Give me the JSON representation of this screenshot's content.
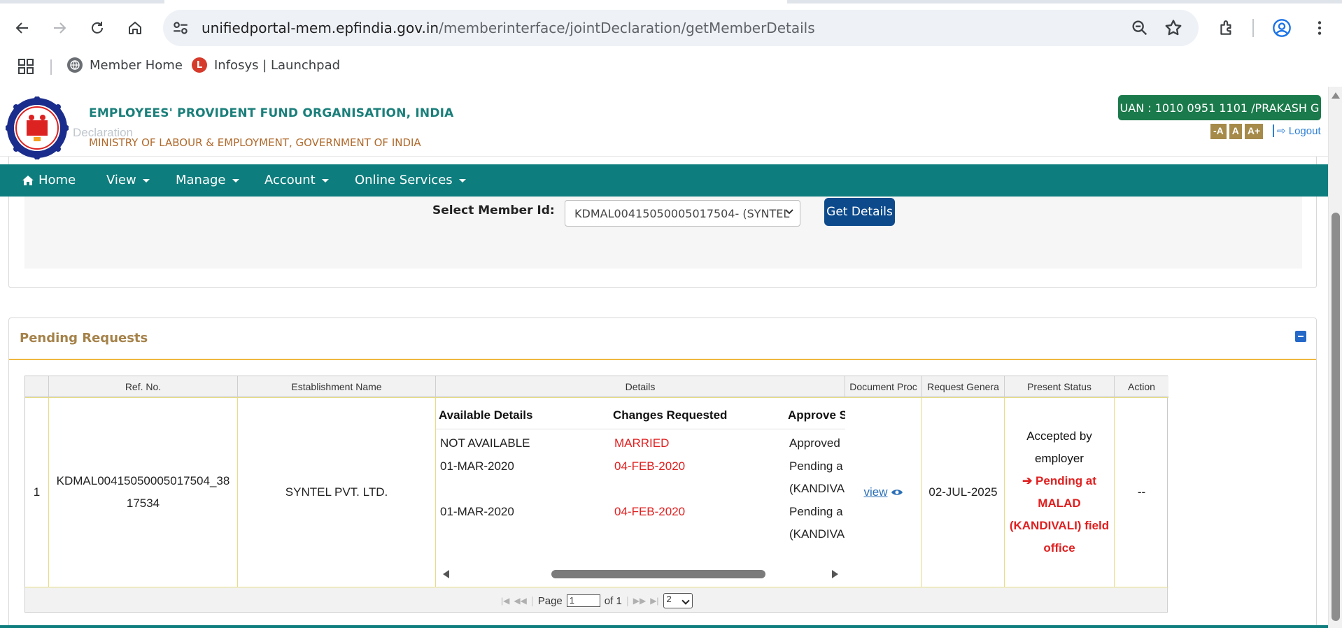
{
  "browser": {
    "url_host": "unifiedportal-mem.epfindia.gov.in",
    "url_path": "/memberinterface/jointDeclaration/getMemberDetails",
    "bookmarks": [
      {
        "label": "Member Home"
      },
      {
        "label": "Infosys | Launchpad"
      }
    ]
  },
  "header": {
    "org_name": "EMPLOYEES' PROVIDENT FUND ORGANISATION, INDIA",
    "ministry": "MINISTRY OF LABOUR & EMPLOYMENT, GOVERNMENT OF INDIA",
    "uan": "UAN : 1010 0951 1101 /PRAKASH G",
    "font_small": "-A",
    "font_normal": "A",
    "font_large": "A+",
    "logout": "Logout",
    "ghost_title": "Declaration"
  },
  "nav": {
    "home": "Home",
    "view": "View",
    "manage": "Manage",
    "account": "Account",
    "online_services": "Online Services"
  },
  "member_select": {
    "label": "Select Member Id:",
    "value": "KDMAL00415050005017504- (SYNTEL",
    "button": "Get Details"
  },
  "pending": {
    "title": "Pending Requests",
    "columns": [
      "Ref. No.",
      "Establishment Name",
      "Details",
      "Document Proc",
      "Request Genera",
      "Present Status",
      "Action"
    ],
    "details_headers": [
      "Available Details",
      "Changes Requested",
      "Approve S"
    ],
    "row": {
      "index": "1",
      "ref_no": "KDMAL00415050005017504_3817534",
      "establishment": "SYNTEL PVT. LTD.",
      "details": [
        {
          "available": "NOT AVAILABLE",
          "changed": "MARRIED",
          "approve": "Approved",
          "approve2": ""
        },
        {
          "available": "01-MAR-2020",
          "changed": "04-FEB-2020",
          "approve": "Pending a",
          "approve2": "(KANDIVA"
        },
        {
          "available": "01-MAR-2020",
          "changed": "04-FEB-2020",
          "approve": "Pending a",
          "approve2": "(KANDIVA"
        }
      ],
      "document": "view",
      "request_date": "02-JUL-2025",
      "status_line1": "Accepted by",
      "status_line2": "employer",
      "status_pending": "Pending at MALAD (KANDIVALI) field office",
      "action": "--"
    },
    "pager": {
      "page_label": "Page",
      "page_value": "1",
      "of_label": "of 1",
      "rows_value": "2"
    }
  }
}
